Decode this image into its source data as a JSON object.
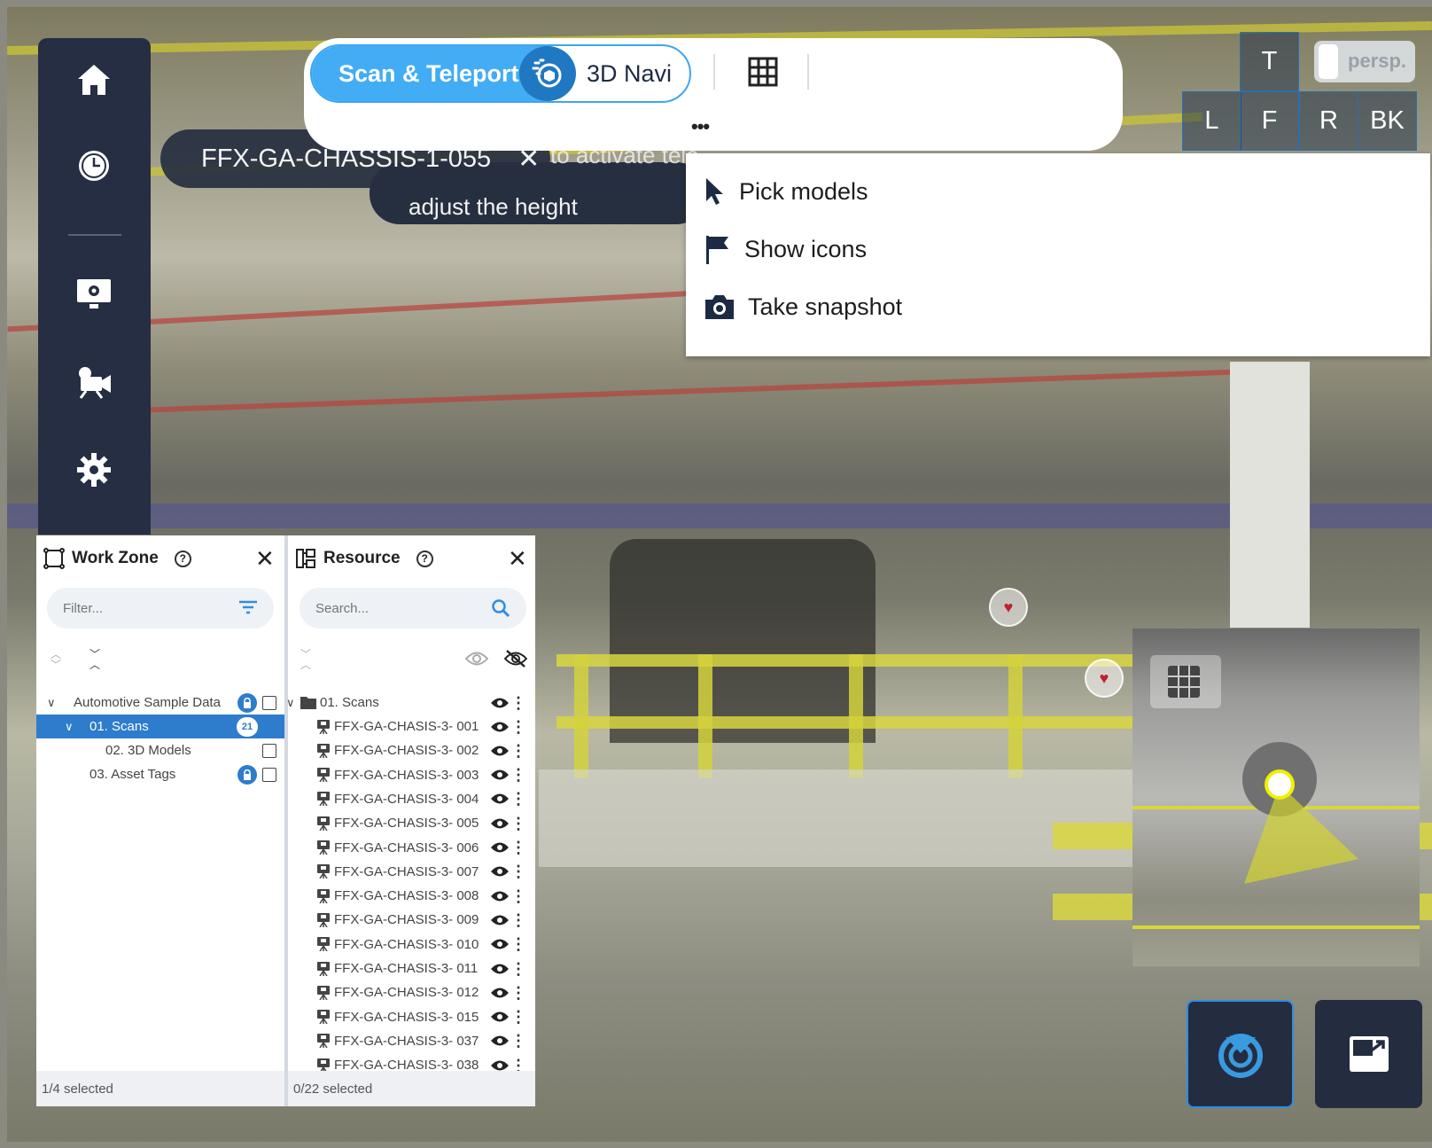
{
  "toolbar": {
    "mode_active": "Scan & Teleport",
    "mode_inactive": "3D Navi",
    "grid_icon": "grid-icon",
    "more_label": "•••"
  },
  "tooltip": {
    "scan_name": "FFX-GA-CHASSIS-1-055",
    "hint_partial": "to activate tele",
    "hint_line2": "adjust the height"
  },
  "menu": {
    "items": [
      {
        "label": "Pick models",
        "icon": "cursor-icon"
      },
      {
        "label": "Show icons",
        "icon": "flag-icon"
      },
      {
        "label": "Take snapshot",
        "icon": "camera-icon"
      }
    ]
  },
  "view_cube": {
    "top": "T",
    "left": "L",
    "front": "F",
    "right": "R",
    "back": "BK",
    "projection": "persp."
  },
  "sidebar": {
    "items": [
      "home-icon",
      "clock-icon",
      "screen-settings-icon",
      "camera-settings-icon",
      "gear-icon"
    ]
  },
  "work_zone": {
    "title": "Work Zone",
    "filter_placeholder": "Filter...",
    "tree": [
      {
        "label": "Automotive Sample Data",
        "locked": true,
        "checked": false
      },
      {
        "label": "01. Scans",
        "count": "21",
        "selected": true
      },
      {
        "label": "02. 3D Models",
        "checked": false
      },
      {
        "label": "03. Asset Tags",
        "locked": true,
        "checked": false
      }
    ],
    "footer": "1/4 selected"
  },
  "resource": {
    "title": "Resource",
    "search_placeholder": "Search...",
    "folder": "01. Scans",
    "items": [
      "FFX-GA-CHASIS-3- 001",
      "FFX-GA-CHASIS-3- 002",
      "FFX-GA-CHASIS-3- 003",
      "FFX-GA-CHASIS-3- 004",
      "FFX-GA-CHASIS-3- 005",
      "FFX-GA-CHASIS-3- 006",
      "FFX-GA-CHASIS-3- 007",
      "FFX-GA-CHASIS-3- 008",
      "FFX-GA-CHASIS-3- 009",
      "FFX-GA-CHASIS-3- 010",
      "FFX-GA-CHASIS-3- 011",
      "FFX-GA-CHASIS-3- 012",
      "FFX-GA-CHASIS-3- 015",
      "FFX-GA-CHASIS-3- 037",
      "FFX-GA-CHASIS-3- 038"
    ],
    "footer": "0/22 selected"
  },
  "colors": {
    "accent": "#42acf5",
    "selection": "#2e7ccc",
    "dark_panel": "#252e42"
  }
}
